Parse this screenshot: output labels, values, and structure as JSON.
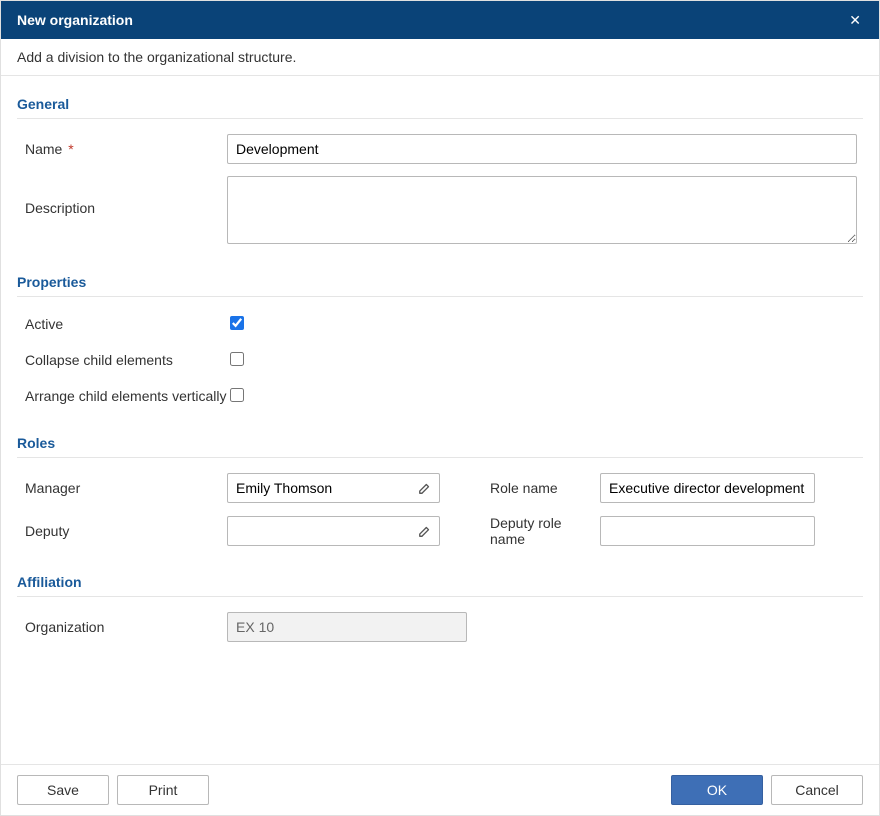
{
  "dialog": {
    "title": "New organization",
    "subtitle": "Add a division to the organizational structure."
  },
  "sections": {
    "general": {
      "title": "General",
      "name_label": "Name",
      "name_value": "Development",
      "description_label": "Description",
      "description_value": ""
    },
    "properties": {
      "title": "Properties",
      "active_label": "Active",
      "active_checked": true,
      "collapse_label": "Collapse child elements",
      "collapse_checked": false,
      "arrange_label": "Arrange child elements vertically",
      "arrange_checked": false
    },
    "roles": {
      "title": "Roles",
      "manager_label": "Manager",
      "manager_value": "Emily Thomson",
      "rolename_label": "Role name",
      "rolename_value": "Executive director development",
      "deputy_label": "Deputy",
      "deputy_value": "",
      "deputy_rolename_label": "Deputy role name",
      "deputy_rolename_value": ""
    },
    "affiliation": {
      "title": "Affiliation",
      "organization_label": "Organization",
      "organization_value": "EX 10"
    }
  },
  "buttons": {
    "save": "Save",
    "print": "Print",
    "ok": "OK",
    "cancel": "Cancel"
  }
}
